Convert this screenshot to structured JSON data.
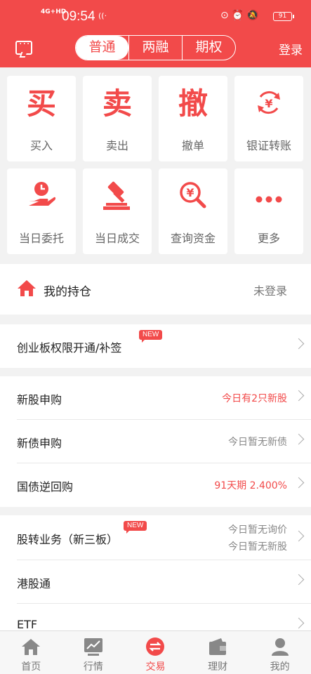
{
  "status_bar": {
    "network": "4G+HD",
    "time": "09:54",
    "battery": "91"
  },
  "header": {
    "segments": [
      {
        "label": "普通",
        "active": true
      },
      {
        "label": "两融",
        "active": false
      },
      {
        "label": "期权",
        "active": false
      }
    ],
    "login": "登录"
  },
  "grid": [
    {
      "glyph": "买",
      "label": "买入"
    },
    {
      "glyph": "卖",
      "label": "卖出"
    },
    {
      "glyph": "撤",
      "label": "撤单"
    },
    {
      "icon": "yuan-exchange-icon",
      "label": "银证转账"
    },
    {
      "icon": "hand-clock-icon",
      "label": "当日委托"
    },
    {
      "icon": "gavel-icon",
      "label": "当日成交"
    },
    {
      "icon": "yuan-search-icon",
      "label": "查询资金"
    },
    {
      "icon": "more-dots-icon",
      "label": "更多"
    }
  ],
  "holding": {
    "title": "我的持仓",
    "status": "未登录"
  },
  "group1": [
    {
      "title": "创业板权限开通/补签",
      "badge": "NEW",
      "value": ""
    }
  ],
  "group2": [
    {
      "title": "新股申购",
      "value": "今日有2只新股",
      "highlight": true
    },
    {
      "title": "新债申购",
      "value": "今日暂无新债",
      "highlight": false
    },
    {
      "title": "国债逆回购",
      "value": "91天期 2.400%",
      "highlight": true
    }
  ],
  "group3": [
    {
      "title": "股转业务（新三板）",
      "badge": "NEW",
      "value_line1": "今日暂无询价",
      "value_line2": "今日暂无新股"
    },
    {
      "title": "港股通"
    },
    {
      "title": "ETF"
    }
  ],
  "tabs": [
    {
      "label": "首页",
      "icon": "home-icon",
      "active": false
    },
    {
      "label": "行情",
      "icon": "chart-icon",
      "active": false
    },
    {
      "label": "交易",
      "icon": "trade-icon",
      "active": true
    },
    {
      "label": "理财",
      "icon": "wallet-icon",
      "active": false
    },
    {
      "label": "我的",
      "icon": "user-icon",
      "active": false
    }
  ],
  "colors": {
    "accent": "#f24a4a"
  }
}
